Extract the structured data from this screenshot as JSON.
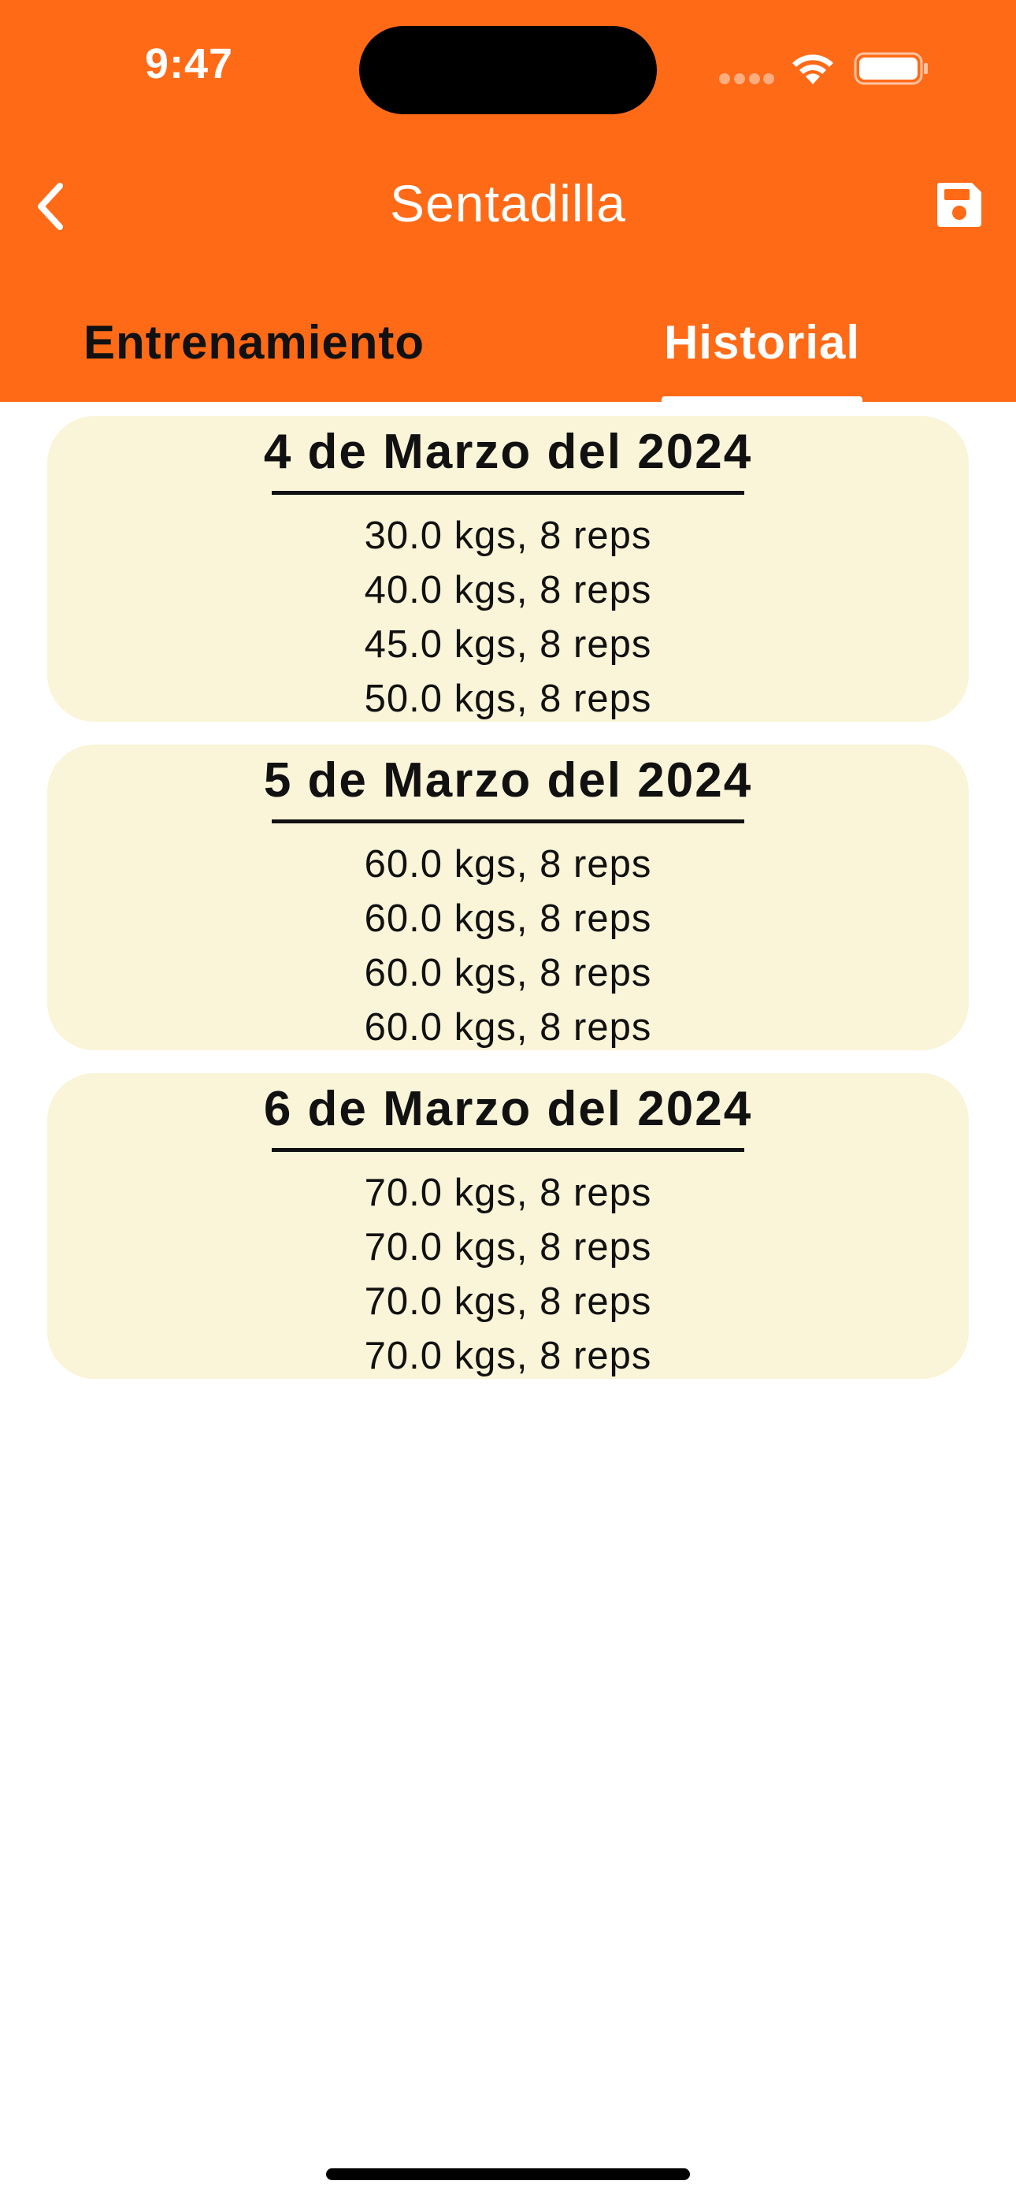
{
  "status_bar": {
    "time": "9:47"
  },
  "nav": {
    "title": "Sentadilla",
    "back_icon": "chevron-left-icon",
    "save_icon": "floppy-disk-icon"
  },
  "tabs": [
    {
      "label": "Entrenamiento",
      "active": false
    },
    {
      "label": "Historial",
      "active": true
    }
  ],
  "history": [
    {
      "date": "4 de Marzo del 2024",
      "sets": [
        "30.0 kgs, 8 reps",
        "40.0 kgs, 8 reps",
        "45.0 kgs, 8 reps",
        "50.0 kgs, 8 reps"
      ]
    },
    {
      "date": "5 de Marzo del 2024",
      "sets": [
        "60.0 kgs, 8 reps",
        "60.0 kgs, 8 reps",
        "60.0 kgs, 8 reps",
        "60.0 kgs, 8 reps"
      ]
    },
    {
      "date": "6 de Marzo del 2024",
      "sets": [
        "70.0 kgs, 8 reps",
        "70.0 kgs, 8 reps",
        "70.0 kgs, 8 reps",
        "70.0 kgs, 8 reps"
      ]
    }
  ],
  "colors": {
    "header": "#ff6a17",
    "card": "#faf4d8",
    "active_tab": "#ffffff",
    "inactive_tab": "#111111"
  }
}
